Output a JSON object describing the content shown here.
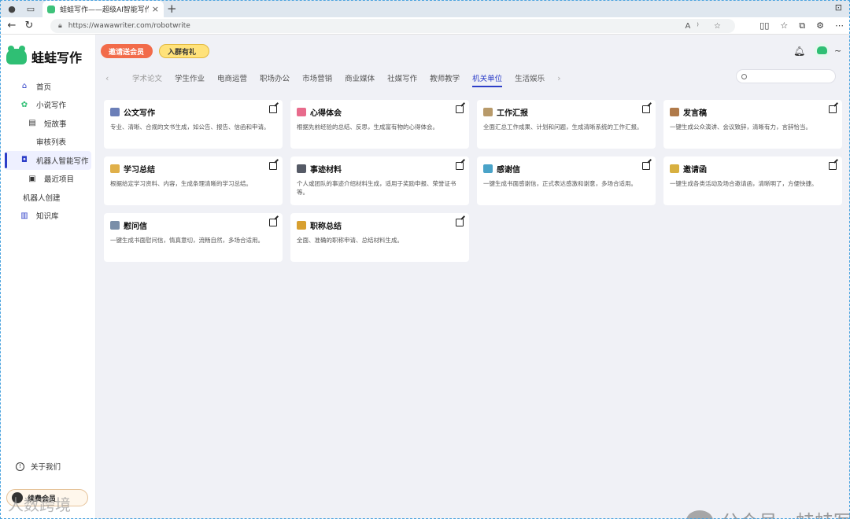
{
  "browser": {
    "tab_title": "蛙蛙写作——超级AI智能写作助",
    "tab_close": "×",
    "new_tab": "+",
    "url": "https://wawawriter.com/robotwrite",
    "url_icons": "A⁾ ☆",
    "tools": [
      "▯▯",
      "☆",
      "⧉",
      "⚙",
      "⋯"
    ],
    "window_control": "⊡"
  },
  "app": {
    "brand": "蛙蛙写作",
    "sidebar": {
      "items": [
        {
          "label": "首页",
          "icon": "home-icon",
          "glyph": "⌂",
          "level": "l0"
        },
        {
          "label": "小说写作",
          "icon": "frog-icon",
          "glyph": "✿",
          "level": "l0"
        },
        {
          "label": "短故事",
          "icon": "book-icon",
          "glyph": "▤",
          "level": "l1"
        },
        {
          "label": "审核列表",
          "icon": "",
          "glyph": "",
          "level": "l1n"
        },
        {
          "label": "机器人智能写作",
          "icon": "robot-icon",
          "glyph": "◘",
          "level": "active"
        },
        {
          "label": "最近项目",
          "icon": "box-icon",
          "glyph": "▣",
          "level": "l1"
        },
        {
          "label": "机器人创建",
          "icon": "",
          "glyph": "",
          "level": "lp"
        },
        {
          "label": "知识库",
          "icon": "library-icon",
          "glyph": "▥",
          "level": "l0"
        }
      ],
      "about": "关于我们",
      "member": "续费会员"
    },
    "promo": [
      "邀请送会员",
      "入群有礼"
    ],
    "header_right": {
      "tilde": "~"
    },
    "categories": [
      "学术论文",
      "学生作业",
      "电商运营",
      "职场办公",
      "市场营销",
      "商业媒体",
      "社媒写作",
      "教师教学",
      "机关单位",
      "生活娱乐"
    ],
    "active_category": "机关单位",
    "arrows": {
      "left": "‹",
      "right": "›"
    },
    "search": {
      "placeholder": ""
    },
    "cards": [
      {
        "title": "公文写作",
        "desc": "专业、清晰、合规的文书生成，如公告、报告、信函和申请。",
        "icon": "open-book-icon",
        "color": "#6b7fb8"
      },
      {
        "title": "心得体会",
        "desc": "根据先前经验的总结、反思，生成富有物的心得体会。",
        "icon": "heart-icon",
        "color": "#e86b8c"
      },
      {
        "title": "工作汇报",
        "desc": "全面汇总工作成果、计划和问题，生成清晰系统的工作汇报。",
        "icon": "notepad-icon",
        "color": "#b89a6a"
      },
      {
        "title": "发言稿",
        "desc": "一键生成公众演讲、会议致辞，清晰有力，言辞恰当。",
        "icon": "scroll-icon",
        "color": "#b07a4a"
      },
      {
        "title": "学习总结",
        "desc": "根据给定学习资料、内容，生成条理清晰的学习总结。",
        "icon": "memo-icon",
        "color": "#e0b04a"
      },
      {
        "title": "事迹材料",
        "desc": "个人或团队的事迹介绍材料生成，适用于奖励申报、荣誉证书等。",
        "icon": "monitor-icon",
        "color": "#555a66"
      },
      {
        "title": "感谢信",
        "desc": "一键生成书面感谢信，正式表达感激和谢意，多场合适用。",
        "icon": "gift-icon",
        "color": "#4aa3c8"
      },
      {
        "title": "邀请函",
        "desc": "一键生成各类活动及场合邀请函，清晰明了，方便快捷。",
        "icon": "ticket-icon",
        "color": "#d8b040"
      },
      {
        "title": "慰问信",
        "desc": "一键生成书面慰问信，情真意切，流畅自然，多场合适用。",
        "icon": "envelope-icon",
        "color": "#7a8ea8"
      },
      {
        "title": "职称总结",
        "desc": "全面、准确的职称申请、总结材料生成。",
        "icon": "medal-icon",
        "color": "#d8a030"
      }
    ]
  },
  "watermark": {
    "text": "公众号 · 蛙蛙写作",
    "text2": "人数跨境"
  }
}
